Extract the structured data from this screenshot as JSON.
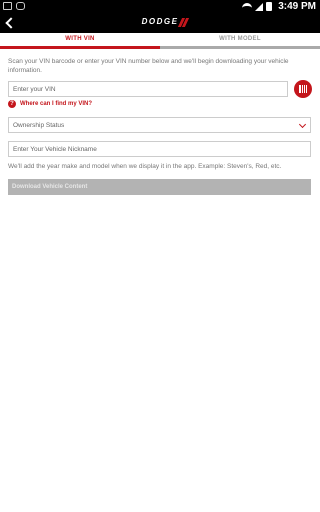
{
  "status_bar": {
    "time": "3:49 PM",
    "icons": [
      "image-icon",
      "message-icon",
      "download-icon",
      "wifi-icon",
      "signal-icon",
      "battery-icon"
    ]
  },
  "app_bar": {
    "brand": "DODGE"
  },
  "tabs": [
    {
      "label": "WITH VIN",
      "active": true
    },
    {
      "label": "WITH MODEL",
      "active": false
    }
  ],
  "form": {
    "intro": "Scan your VIN barcode or enter your VIN number below and we'll begin downloading your vehicle information.",
    "vin_placeholder": "Enter your VIN",
    "help_link": "Where can I find my VIN?",
    "ownership_label": "Ownership Status",
    "nickname_placeholder": "Enter Your Vehicle Nickname",
    "note": "We'll add the year make and model when we display it in the app. Example: Steven's, Red, etc.",
    "download_label": "Download Vehicle Content"
  },
  "colors": {
    "accent": "#c4161c",
    "bar": "#000000",
    "disabled": "#b3b3b3"
  }
}
